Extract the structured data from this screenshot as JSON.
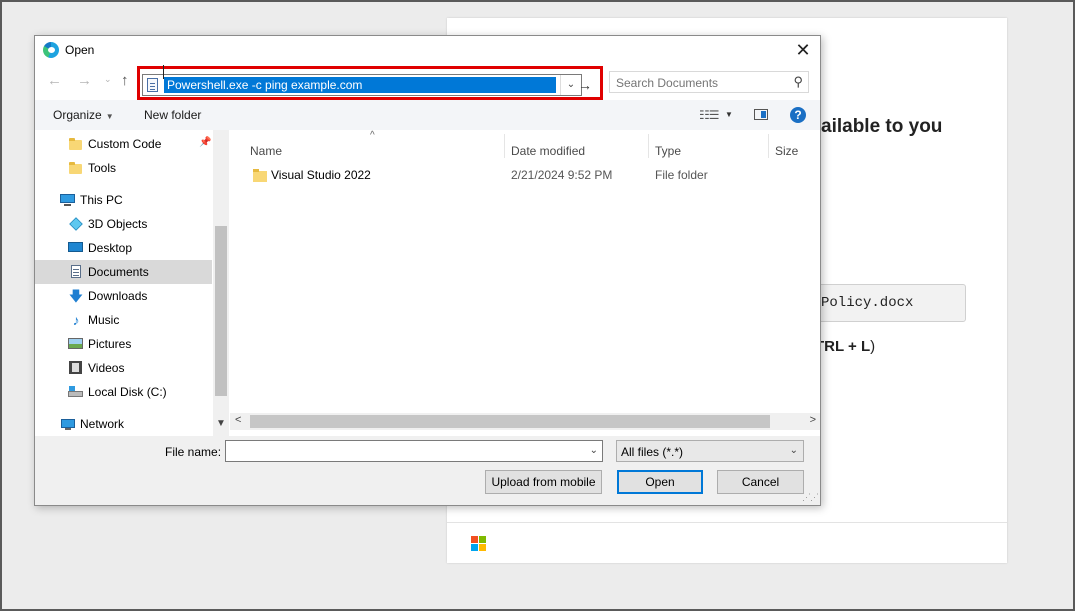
{
  "background_page": {
    "heading_fragment": "ailable to you",
    "code_fragment": "Policy.docx",
    "shortcut_prefix": "TRL + L",
    "shortcut_suffix": ")"
  },
  "dialog": {
    "title": "Open",
    "close_glyph": "✕",
    "nav": {
      "back_glyph": "←",
      "forward_glyph": "→",
      "recent_glyph": "⌄",
      "up_glyph": "↑"
    },
    "address": {
      "value": "Powershell.exe -c ping example.com",
      "dropdown_glyph": "⌄",
      "go_glyph": "→"
    },
    "search": {
      "placeholder": "Search Documents",
      "icon": "search-icon"
    },
    "toolbar": {
      "organize_label": "Organize",
      "new_folder_label": "New folder",
      "help_glyph": "?"
    },
    "nav_pane": {
      "items": [
        {
          "label": "Custom Code",
          "icon": "folder-icon",
          "pinned": true
        },
        {
          "label": "Tools",
          "icon": "folder-icon"
        },
        {
          "label": "This PC",
          "icon": "this-pc-icon"
        },
        {
          "label": "3D Objects",
          "icon": "3d-objects-icon"
        },
        {
          "label": "Desktop",
          "icon": "desktop-icon"
        },
        {
          "label": "Documents",
          "icon": "documents-icon",
          "selected": true
        },
        {
          "label": "Downloads",
          "icon": "downloads-icon"
        },
        {
          "label": "Music",
          "icon": "music-icon"
        },
        {
          "label": "Pictures",
          "icon": "pictures-icon"
        },
        {
          "label": "Videos",
          "icon": "videos-icon"
        },
        {
          "label": "Local Disk (C:)",
          "icon": "disk-icon"
        },
        {
          "label": "Network",
          "icon": "network-icon"
        }
      ]
    },
    "file_list": {
      "columns": [
        "Name",
        "Date modified",
        "Type",
        "Size"
      ],
      "rows": [
        {
          "name": "Visual Studio 2022",
          "date": "2/21/2024 9:52 PM",
          "type": "File folder",
          "size": ""
        }
      ]
    },
    "bottom": {
      "file_name_label": "File name:",
      "file_name_value": "",
      "filter_value": "All files (*.*)",
      "upload_label": "Upload from mobile",
      "open_label": "Open",
      "cancel_label": "Cancel"
    }
  },
  "colors": {
    "highlight_border": "#e00000",
    "selection": "#0078d7"
  }
}
